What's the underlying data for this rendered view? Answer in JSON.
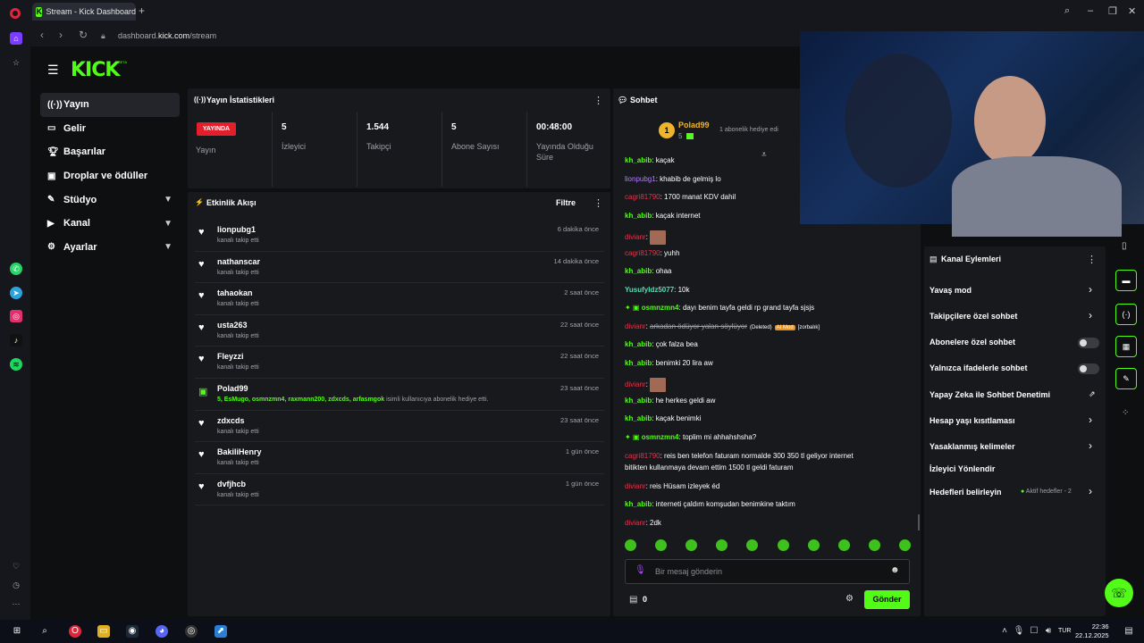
{
  "browser": {
    "tab_title": "Stream - Kick Dashboard",
    "url_prefix": "dashboard.",
    "url_domain": "kick.com",
    "url_path": "/stream"
  },
  "header": {
    "logo": "KICK",
    "logo_badge": "BETA"
  },
  "nav": [
    {
      "label": "Yayın",
      "icon": "broadcast-icon",
      "active": true
    },
    {
      "label": "Gelir",
      "icon": "wallet-icon"
    },
    {
      "label": "Başarılar",
      "icon": "trophy-icon"
    },
    {
      "label": "Droplar ve ödüller",
      "icon": "gift-icon"
    },
    {
      "label": "Stüdyo",
      "icon": "studio-icon",
      "expandable": true
    },
    {
      "label": "Kanal",
      "icon": "channel-icon",
      "expandable": true
    },
    {
      "label": "Ayarlar",
      "icon": "gear-icon",
      "expandable": true
    }
  ],
  "stats": {
    "title": "Yayın İstatistikleri",
    "live_badge": "YAYINDA",
    "live_label": "Yayın",
    "items": [
      {
        "value": "5",
        "label": "İzleyici"
      },
      {
        "value": "1.544",
        "label": "Takipçi"
      },
      {
        "value": "5",
        "label": "Abone Sayısı"
      },
      {
        "value": "00:48:00",
        "label": "Yayında Olduğu Süre"
      }
    ]
  },
  "activity": {
    "title": "Etkinlik Akışı",
    "filter": "Filtre",
    "rows": [
      {
        "user": "lionpubg1",
        "desc": "kanalı takip etti",
        "time": "6 dakika önce",
        "type": "follow"
      },
      {
        "user": "nathanscar",
        "desc": "kanalı takip etti",
        "time": "14 dakika önce",
        "type": "follow"
      },
      {
        "user": "tahaokan",
        "desc": "kanalı takip etti",
        "time": "2 saat önce",
        "type": "follow"
      },
      {
        "user": "usta263",
        "desc": "kanalı takip etti",
        "time": "22 saat önce",
        "type": "follow"
      },
      {
        "user": "Fleyzzi",
        "desc": "kanalı takip etti",
        "time": "22 saat önce",
        "type": "follow"
      },
      {
        "user": "Polad99",
        "desc_green": "5, EsMugo, osmnzmn4, raxmann200, zdxcds, arfasmgok",
        "desc": " isimli kullanıcıya abonelik hediye etti.",
        "time": "23 saat önce",
        "type": "gift"
      },
      {
        "user": "zdxcds",
        "desc": "kanalı takip etti",
        "time": "23 saat önce",
        "type": "follow"
      },
      {
        "user": "BakiliHenry",
        "desc": "kanalı takip etti",
        "time": "1 gün önce",
        "type": "follow"
      },
      {
        "user": "dvfjhcb",
        "desc": "kanalı takip etti",
        "time": "1 gün önce",
        "type": "follow"
      }
    ]
  },
  "chat": {
    "title": "Sohbet",
    "pinned_rank": "1",
    "pinned_user": "Polad99",
    "pinned_count": "5",
    "pinned_text": "1 abonelik hediye edi",
    "messages": [
      {
        "user": "kh_abib",
        "cls": "u-green",
        "text": "kaçak"
      },
      {
        "user": "lionpubg1",
        "cls": "u-purple",
        "text": "khabib de gelmiş lo"
      },
      {
        "user": "cagri81790",
        "cls": "u-red",
        "text": "1700 manat KDV dahil"
      },
      {
        "user": "kh_abib",
        "cls": "u-green",
        "text": "kaçak internet"
      },
      {
        "user": "divianr",
        "cls": "u-red",
        "text": "",
        "emote": true
      },
      {
        "user": "cagri81790",
        "cls": "u-red",
        "text": "yuhh"
      },
      {
        "user": "kh_abib",
        "cls": "u-green",
        "text": "ohaa"
      },
      {
        "user": "YusufyIdz5077",
        "cls": "u-teal",
        "text": "10k"
      },
      {
        "user": "osmnzmn4",
        "cls": "u-green",
        "text": "dayı benim tayfa geldi rp grand tayfa sjsjs"
      },
      {
        "user": "divianr",
        "cls": "u-red",
        "text": "arkadan ödüyor yalan söylüyor",
        "deleted": "(Deleted)",
        "mod": "AI Mod",
        "tag": "[zorbalık]"
      },
      {
        "user": "kh_abib",
        "cls": "u-green",
        "text": "çok falza bea"
      },
      {
        "user": "kh_abib",
        "cls": "u-green",
        "text": "benimki 20 lira aw"
      },
      {
        "user": "divianr",
        "cls": "u-red",
        "text": "",
        "emote": true
      },
      {
        "user": "kh_abib",
        "cls": "u-green",
        "text": "he herkes geldi aw"
      },
      {
        "user": "kh_abib",
        "cls": "u-green",
        "text": "kaçak benimki"
      },
      {
        "user": "osmnzmn4",
        "cls": "u-green",
        "text": "toplim mi ahhahshsha?"
      },
      {
        "user": "cagri81790",
        "cls": "u-red",
        "text": "reis ben telefon faturam normalde 300 350 tl geliyor internet",
        "text2": "bitikten kullanmaya devam ettim 1500 tl geldi faturam"
      },
      {
        "user": "divianr",
        "cls": "u-red",
        "text": "reis Hüsam izleyek éd"
      },
      {
        "user": "kh_abib",
        "cls": "u-green",
        "text": "interneti çaldım komşudan benimkine taktım"
      },
      {
        "user": "divianr",
        "cls": "u-red",
        "text": "2dk"
      }
    ],
    "input_placeholder": "Bir mesaj gönderin",
    "points": "0",
    "send": "Gönder"
  },
  "actions": {
    "title": "Kanal Eylemleri",
    "items": [
      {
        "label": "Yavaş mod",
        "control": "chevron"
      },
      {
        "label": "Takipçilere özel sohbet",
        "control": "chevron"
      },
      {
        "label": "Abonelere özel sohbet",
        "control": "toggle"
      },
      {
        "label": "Yalnızca ifadelerle sohbet",
        "control": "toggle"
      },
      {
        "label": "Yapay Zeka ile Sohbet Denetimi",
        "control": "external"
      },
      {
        "label": "Hesap yaşı kısıtlaması",
        "control": "chevron"
      },
      {
        "label": "Yasaklanmış kelimeler",
        "control": "chevron"
      },
      {
        "label": "İzleyici Yönlendir",
        "control": "none"
      },
      {
        "label": "Hedefleri belirleyin",
        "control": "chevron",
        "extra": "Aktif hedefler - 2"
      }
    ]
  },
  "taskbar": {
    "lang": "TUR",
    "time": "22:36",
    "date": "22.12.2025"
  },
  "colors": {
    "accent": "#53fc18",
    "live": "#e21f2b",
    "panel": "#18191d",
    "bg": "#0e0f11"
  }
}
